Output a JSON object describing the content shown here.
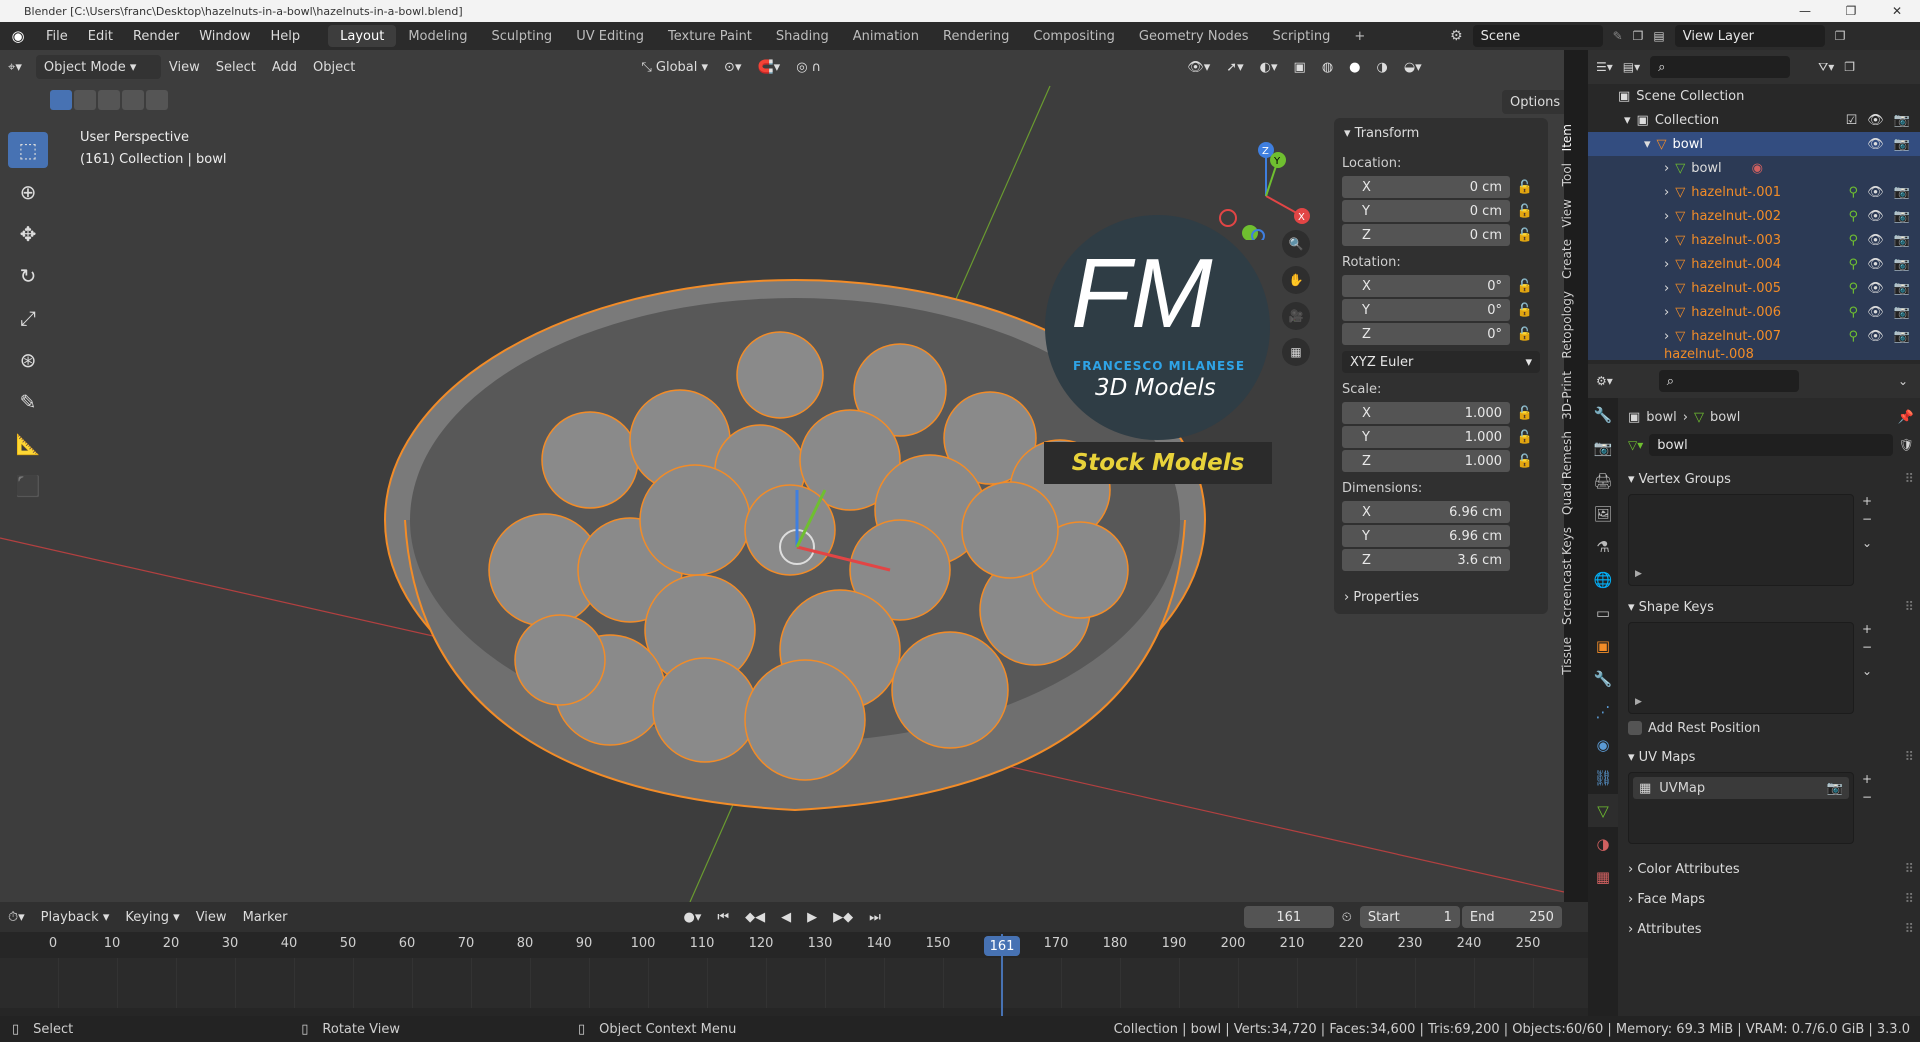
{
  "window": {
    "title": "Blender [C:\\Users\\franc\\Desktop\\hazelnuts-in-a-bowl\\hazelnuts-in-a-bowl.blend]",
    "min": "—",
    "max": "❐",
    "close": "✕"
  },
  "menu": [
    "File",
    "Edit",
    "Render",
    "Window",
    "Help"
  ],
  "workspaces": [
    "Layout",
    "Modeling",
    "Sculpting",
    "UV Editing",
    "Texture Paint",
    "Shading",
    "Animation",
    "Rendering",
    "Compositing",
    "Geometry Nodes",
    "Scripting"
  ],
  "workspace_add": "+",
  "active_workspace": "Layout",
  "scene": {
    "label": "Scene",
    "view_layer": "View Layer"
  },
  "viewport": {
    "mode": "Object Mode",
    "menus": [
      "View",
      "Select",
      "Add",
      "Object"
    ],
    "orientation": "Global",
    "options": "Options",
    "perspective": "User Perspective",
    "collection_info": "(161) Collection | bowl"
  },
  "logo": {
    "initials": "FM",
    "name": "FRANCESCO MILANESE",
    "tagline": "3D Models",
    "banner": "Stock Models"
  },
  "gizmo": {
    "z": "Z",
    "y": "Y",
    "x": "X"
  },
  "n_panel": {
    "section": "Transform",
    "location_label": "Location:",
    "location": [
      {
        "axis": "X",
        "value": "0 cm"
      },
      {
        "axis": "Y",
        "value": "0 cm"
      },
      {
        "axis": "Z",
        "value": "0 cm"
      }
    ],
    "rotation_label": "Rotation:",
    "rotation": [
      {
        "axis": "X",
        "value": "0°"
      },
      {
        "axis": "Y",
        "value": "0°"
      },
      {
        "axis": "Z",
        "value": "0°"
      }
    ],
    "rotation_mode": "XYZ Euler",
    "scale_label": "Scale:",
    "scale": [
      {
        "axis": "X",
        "value": "1.000"
      },
      {
        "axis": "Y",
        "value": "1.000"
      },
      {
        "axis": "Z",
        "value": "1.000"
      }
    ],
    "dimensions_label": "Dimensions:",
    "dimensions": [
      {
        "axis": "X",
        "value": "6.96 cm"
      },
      {
        "axis": "Y",
        "value": "6.96 cm"
      },
      {
        "axis": "Z",
        "value": "3.6 cm"
      }
    ],
    "properties": "Properties",
    "tabs": [
      "Item",
      "Tool",
      "View",
      "Create",
      "Retopology",
      "3D-Print",
      "Quad Remesh",
      "Screencast Keys",
      "Tissue"
    ]
  },
  "outliner": {
    "scene_collection": "Scene Collection",
    "collection": "Collection",
    "selected": "bowl",
    "mesh": "bowl",
    "items": [
      "hazelnut-.001",
      "hazelnut-.002",
      "hazelnut-.003",
      "hazelnut-.004",
      "hazelnut-.005",
      "hazelnut-.006",
      "hazelnut-.007"
    ],
    "partial_item": "hazelnut-.008"
  },
  "properties": {
    "breadcrumb_obj": "bowl",
    "breadcrumb_data": "bowl",
    "data_name": "bowl",
    "vertex_groups": "Vertex Groups",
    "shape_keys": "Shape Keys",
    "add_rest_position": "Add Rest Position",
    "uv_maps": "UV Maps",
    "uv_map_item": "UVMap",
    "color_attributes": "Color Attributes",
    "face_maps": "Face Maps",
    "attributes": "Attributes"
  },
  "timeline": {
    "menus": [
      "Playback",
      "Keying",
      "View",
      "Marker"
    ],
    "current_frame": "161",
    "start_label": "Start",
    "start": "1",
    "end_label": "End",
    "end": "250",
    "ticks": [
      "0",
      "10",
      "20",
      "30",
      "40",
      "50",
      "60",
      "70",
      "80",
      "90",
      "100",
      "110",
      "120",
      "130",
      "140",
      "150",
      "161",
      "170",
      "180",
      "190",
      "200",
      "210",
      "220",
      "230",
      "240",
      "250"
    ]
  },
  "status": {
    "select": "Select",
    "rotate": "Rotate View",
    "context": "Object Context Menu",
    "stats": "Collection | bowl | Verts:34,720 | Faces:34,600 | Tris:69,200 | Objects:60/60 | Memory: 69.3 MiB | VRAM: 0.7/6.0 GiB | 3.3.0"
  },
  "colors": {
    "accent": "#4772b3",
    "selection": "#f28c28",
    "header": "#303030",
    "viewport": "#3d3d3d"
  }
}
